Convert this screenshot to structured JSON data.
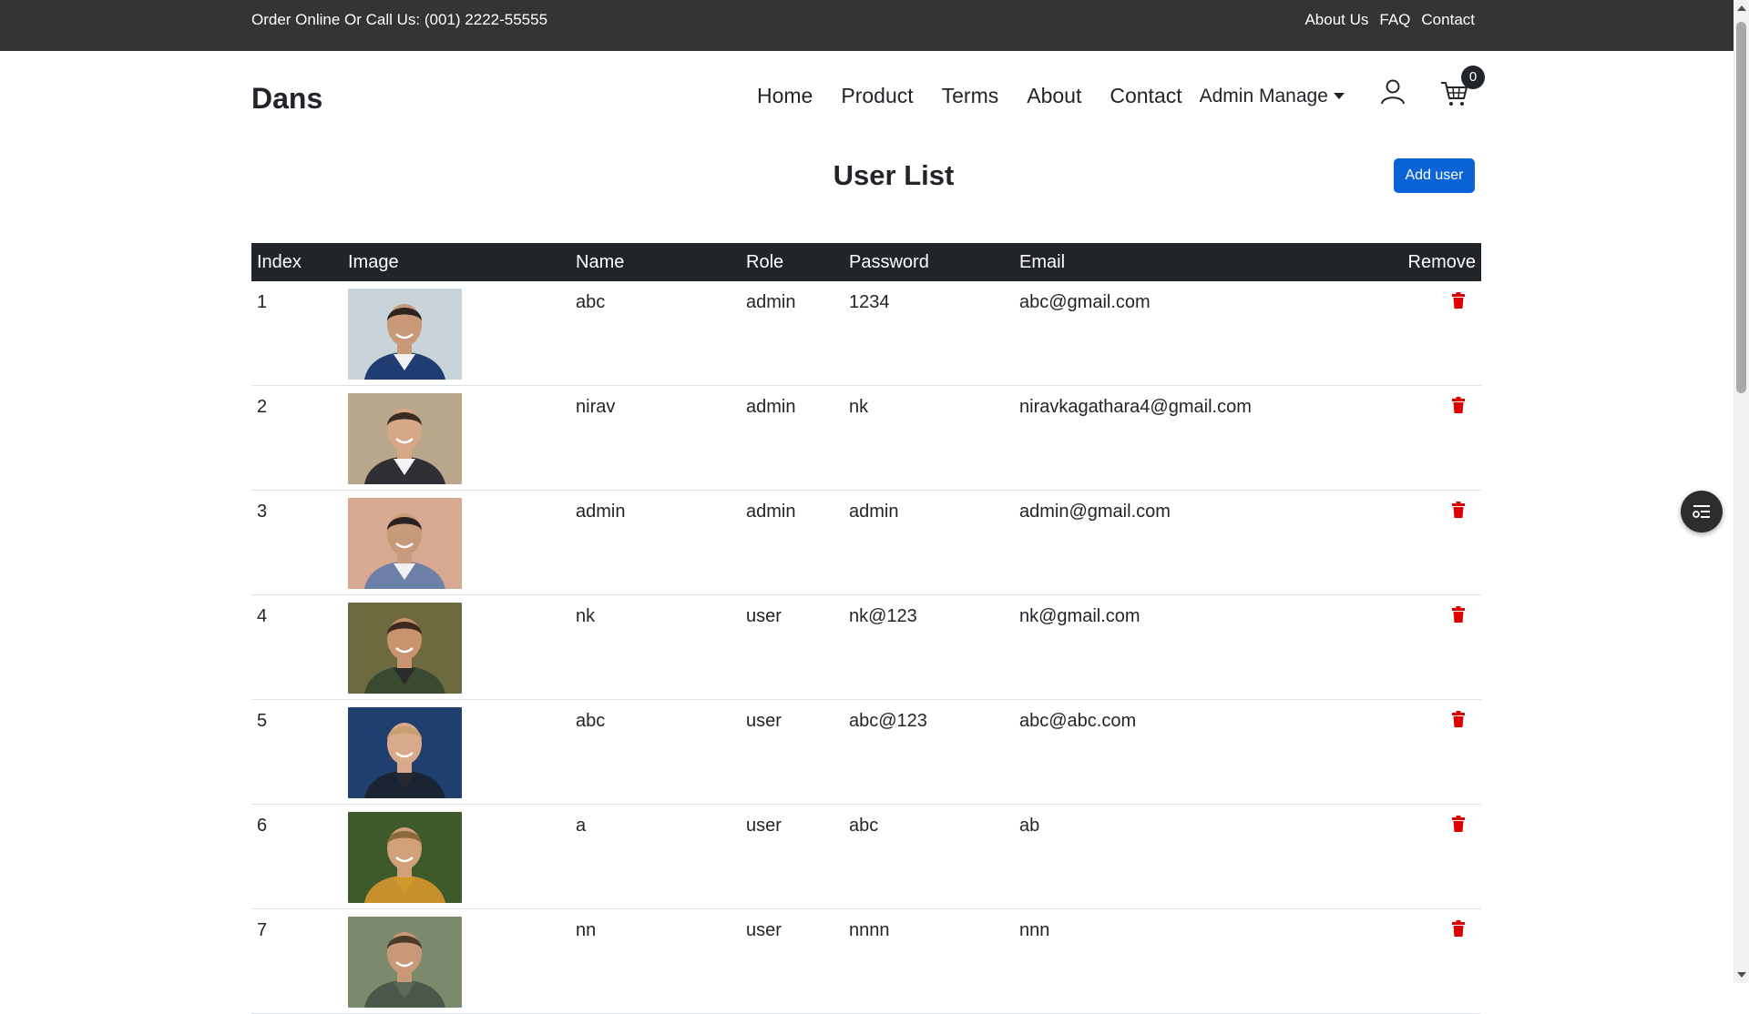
{
  "topbar": {
    "phone_text": "Order Online Or Call Us: (001) 2222-55555",
    "links": [
      "About Us",
      "FAQ",
      "Contact"
    ]
  },
  "navbar": {
    "brand": "Dans",
    "items": [
      "Home",
      "Product",
      "Terms",
      "About",
      "Contact"
    ],
    "dropdown_label": "Admin Manage",
    "cart_count": "0"
  },
  "page": {
    "title": "User List",
    "add_user_label": "Add user"
  },
  "table": {
    "headers": [
      "Index",
      "Image",
      "Name",
      "Role",
      "Password",
      "Email",
      "Remove"
    ],
    "rows": [
      {
        "index": "1",
        "name": "abc",
        "role": "admin",
        "password": "1234",
        "email": "abc@gmail.com"
      },
      {
        "index": "2",
        "name": "nirav",
        "role": "admin",
        "password": "nk",
        "email": "niravkagathara4@gmail.com"
      },
      {
        "index": "3",
        "name": "admin",
        "role": "admin",
        "password": "admin",
        "email": "admin@gmail.com"
      },
      {
        "index": "4",
        "name": "nk",
        "role": "user",
        "password": "nk@123",
        "email": "nk@gmail.com"
      },
      {
        "index": "5",
        "name": "abc",
        "role": "user",
        "password": "abc@123",
        "email": "abc@abc.com"
      },
      {
        "index": "6",
        "name": "a",
        "role": "user",
        "password": "abc",
        "email": "ab"
      },
      {
        "index": "7",
        "name": "nn",
        "role": "user",
        "password": "nnnn",
        "email": "nnn"
      }
    ]
  },
  "colors": {
    "topbar_bg": "#343434",
    "table_header_bg": "#212529",
    "primary_button": "#0a64d8",
    "trash_icon": "#dc0000"
  },
  "icons": {
    "user": "person-outline-icon",
    "cart": "shopping-cart-icon",
    "remove": "trash-icon",
    "floating": "filter-list-icon"
  }
}
